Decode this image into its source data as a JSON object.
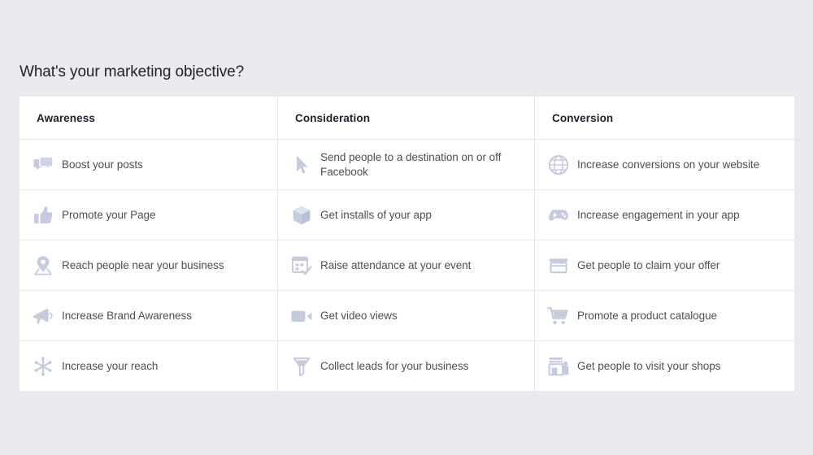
{
  "page": {
    "title": "What's your marketing objective?",
    "background_color": "#e9eaee",
    "card_color": "#ffffff",
    "icon_color": "#c5cbdd",
    "text_color": "#4b4f56",
    "heading_color": "#1d2129"
  },
  "table": {
    "columns": [
      {
        "header": "Awareness",
        "rows": [
          {
            "icon": "boost-posts-icon",
            "label": "Boost your posts"
          },
          {
            "icon": "thumbs-up-icon",
            "label": "Promote your Page"
          },
          {
            "icon": "location-pin-icon",
            "label": "Reach people near your business"
          },
          {
            "icon": "megaphone-icon",
            "label": "Increase Brand Awareness"
          },
          {
            "icon": "reach-starburst-icon",
            "label": "Increase your reach"
          }
        ]
      },
      {
        "header": "Consideration",
        "rows": [
          {
            "icon": "cursor-arrow-icon",
            "label": "Send people to a destination on or off Facebook"
          },
          {
            "icon": "app-install-box-icon",
            "label": "Get installs of your app"
          },
          {
            "icon": "event-calendar-icon",
            "label": "Raise attendance at your event"
          },
          {
            "icon": "video-camera-icon",
            "label": "Get video views"
          },
          {
            "icon": "lead-funnel-icon",
            "label": "Collect leads for your business"
          }
        ]
      },
      {
        "header": "Conversion",
        "rows": [
          {
            "icon": "globe-icon",
            "label": "Increase conversions on your website"
          },
          {
            "icon": "gamepad-icon",
            "label": "Increase engagement in your app"
          },
          {
            "icon": "offer-coupon-icon",
            "label": "Get people to claim your offer"
          },
          {
            "icon": "shopping-cart-icon",
            "label": "Promote a product catalogue"
          },
          {
            "icon": "storefront-person-icon",
            "label": "Get people to visit your shops"
          }
        ]
      }
    ]
  }
}
